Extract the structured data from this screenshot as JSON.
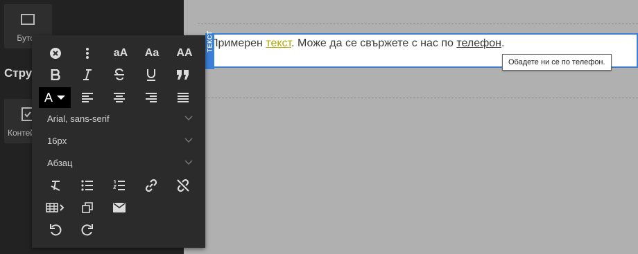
{
  "sidebar": {
    "tiles": [
      {
        "label": "Бутон",
        "icon": "button-block-icon"
      },
      {
        "label": "Контейнер",
        "icon": "form-block-icon"
      }
    ],
    "section_title": "Структура"
  },
  "editor": {
    "badge_text": "ТЕКСТ",
    "text_before": "Примерен ",
    "link_text": "текст",
    "text_middle": ". Може да се свържете с нас по ",
    "phone_link_text": "телефон",
    "text_after": ".",
    "tooltip": "Обадете ни се по телефон."
  },
  "toolbar": {
    "row1": [
      "close-icon",
      "more-vertical-icon",
      "aA",
      "Aa",
      "AA"
    ],
    "row2": [
      "bold-icon",
      "italic-icon",
      "strikethrough-icon",
      "underline-icon",
      "blockquote-icon"
    ],
    "color_label": "A",
    "font_family": "Arial, sans-serif",
    "font_size": "16px",
    "block_format": "Абзац",
    "colors": {
      "panel_bg": "#2b2b2b",
      "icon": "#dcdcdc",
      "selection": "#3b7fd6",
      "link_highlight": "#b5a800"
    }
  }
}
